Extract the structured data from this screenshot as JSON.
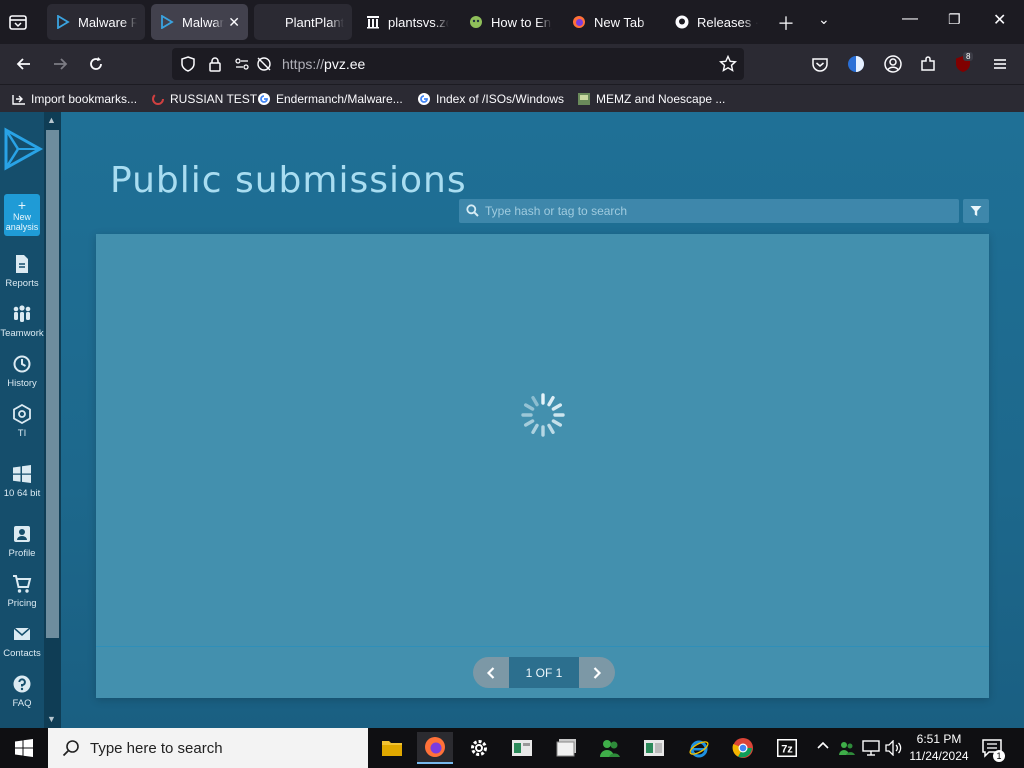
{
  "tabs": [
    {
      "title": "Malware Re"
    },
    {
      "title": "Malware",
      "close": "✕"
    },
    {
      "title": "PlantPlant v"
    },
    {
      "title": "plantsvs.zo"
    },
    {
      "title": "How to Enj"
    },
    {
      "title": "New Tab"
    },
    {
      "title": "Releases · I"
    }
  ],
  "address": {
    "scheme": "https://",
    "host": "pvz.ee"
  },
  "extension_badge": "8",
  "bookmarks": [
    {
      "label": "Import bookmarks..."
    },
    {
      "label": "RUSSIAN TEST"
    },
    {
      "label": "Endermanch/Malware..."
    },
    {
      "label": "Index of /ISOs/Windows"
    },
    {
      "label": "MEMZ and Noescape ..."
    }
  ],
  "sidebar": {
    "new_analysis": "New analysis",
    "items": [
      {
        "label": "Reports",
        "icon": "report-icon"
      },
      {
        "label": "Teamwork",
        "icon": "team-icon"
      },
      {
        "label": "History",
        "icon": "history-icon"
      },
      {
        "label": "TI",
        "icon": "ti-icon"
      },
      {
        "label": "10 64 bit",
        "icon": "windows-icon"
      },
      {
        "label": "Profile",
        "icon": "profile-icon"
      },
      {
        "label": "Pricing",
        "icon": "cart-icon"
      },
      {
        "label": "Contacts",
        "icon": "mail-icon"
      },
      {
        "label": "FAQ",
        "icon": "help-icon"
      }
    ]
  },
  "main": {
    "title": "Public submissions",
    "search_placeholder": "Type hash or tag to search",
    "pager": {
      "label": "1 OF 1"
    }
  },
  "taskbar": {
    "search_placeholder": "Type here to search",
    "time": "6:51 PM",
    "date": "11/24/2024",
    "notification_count": "1"
  },
  "colors": {
    "page_bg": "#1f7096",
    "panel_bg": "#4390ae",
    "accent": "#1f9bd6",
    "title": "#a9ddf1"
  }
}
